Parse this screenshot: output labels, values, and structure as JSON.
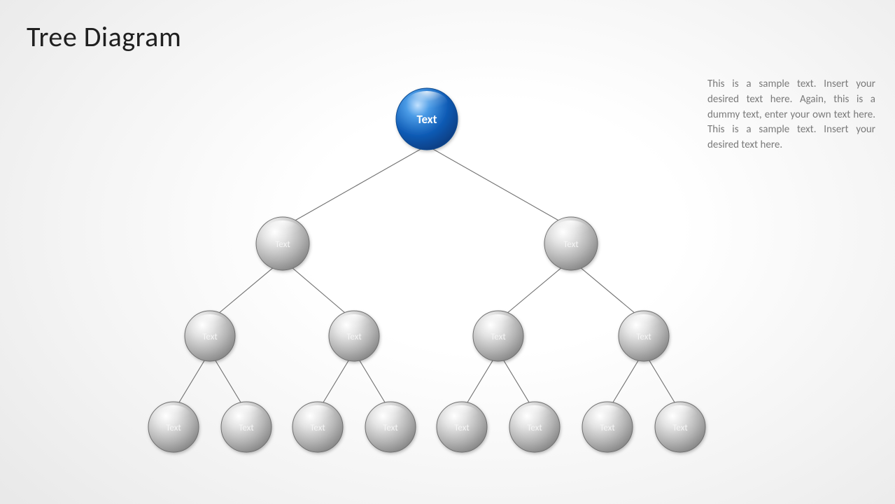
{
  "title": "Tree Diagram",
  "caption": "This is a sample text. Insert your desired text here. Again, this is a dummy text, enter your own text here. This is a sample text. Insert your desired text here.",
  "tree": {
    "root": {
      "label": "Text"
    },
    "level2": [
      {
        "label": "Text"
      },
      {
        "label": "Text"
      }
    ],
    "level3": [
      {
        "label": "Text"
      },
      {
        "label": "Text"
      },
      {
        "label": "Text"
      },
      {
        "label": "Text"
      }
    ],
    "level4": [
      {
        "label": "Text"
      },
      {
        "label": "Text"
      },
      {
        "label": "Text"
      },
      {
        "label": "Text"
      },
      {
        "label": "Text"
      },
      {
        "label": "Text"
      },
      {
        "label": "Text"
      },
      {
        "label": "Text"
      }
    ]
  },
  "colors": {
    "root_fill_top": "#8fc8ff",
    "root_fill_mid": "#1e74d2",
    "root_fill_bot": "#0a4fa0",
    "gray_top": "#f8f8f8",
    "gray_mid": "#cfcfcf",
    "gray_bot": "#8a8a8a",
    "stroke": "#606060"
  }
}
